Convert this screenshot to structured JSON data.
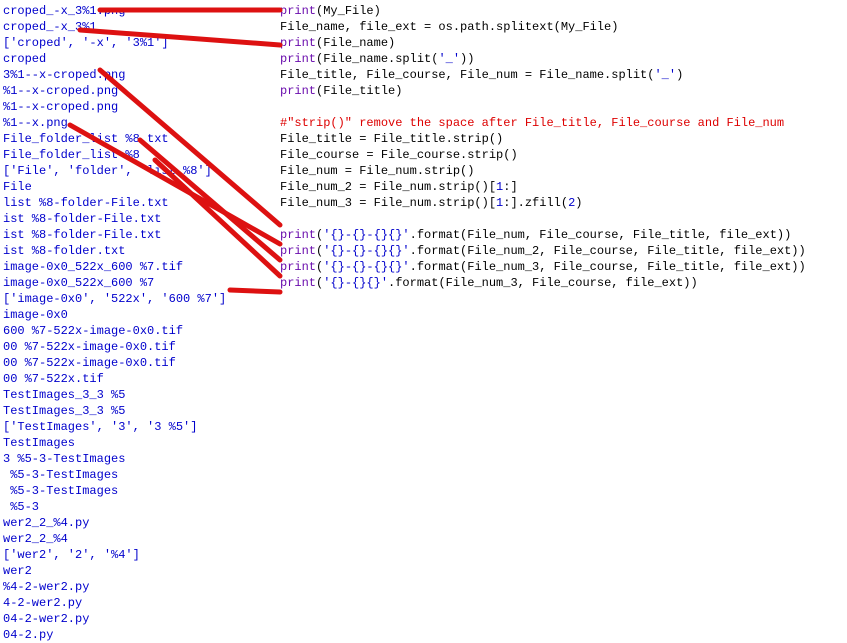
{
  "output": {
    "lines": [
      "croped_-x_3%1.png",
      "croped_-x_3%1",
      "['croped', '-x', '3%1']",
      "croped",
      "3%1--x-croped.png",
      "%1--x-croped.png",
      "%1--x-croped.png",
      "%1--x.png",
      "File_folder_list %8.txt",
      "File_folder_list %8",
      "['File', 'folder', 'list %8']",
      "File",
      "list %8-folder-File.txt",
      "ist %8-folder-File.txt",
      "ist %8-folder-File.txt",
      "ist %8-folder.txt",
      "image-0x0_522x_600 %7.tif",
      "image-0x0_522x_600 %7",
      "['image-0x0', '522x', '600 %7']",
      "image-0x0",
      "600 %7-522x-image-0x0.tif",
      "00 %7-522x-image-0x0.tif",
      "00 %7-522x-image-0x0.tif",
      "00 %7-522x.tif",
      "TestImages_3_3 %5",
      "TestImages_3_3 %5",
      "['TestImages', '3', '3 %5']",
      "TestImages",
      "3 %5-3-TestImages",
      " %5-3-TestImages",
      " %5-3-TestImages",
      " %5-3",
      "wer2_2_%4.py",
      "wer2_2_%4",
      "['wer2', '2', '%4']",
      "wer2",
      "%4-2-wer2.py",
      "4-2-wer2.py",
      "04-2-wer2.py",
      "04-2.py"
    ]
  },
  "code": {
    "l1_fn": "print",
    "l1_rest": "(My_File)",
    "l2": "File_name, file_ext = os.path.splitext(My_File)",
    "l3_fn": "print",
    "l3_rest": "(File_name)",
    "l4_fn": "print",
    "l4_a": "(File_name.split(",
    "l4_str": "'_'",
    "l4_b": "))",
    "l5a": "File_title, File_course, File_num = File_name.split(",
    "l5_str": "'_'",
    "l5b": ")",
    "l6_fn": "print",
    "l6_rest": "(File_title)",
    "l_cmt": "#\"strip()\" remove the space after File_title, File_course and File_num",
    "l8": "File_title = File_title.strip()",
    "l9": "File_course = File_course.strip()",
    "l10": "File_num = File_num.strip()",
    "l11a": "File_num_2 = File_num.strip()[",
    "l11n": "1",
    "l11b": ":]",
    "l12a": "File_num_3 = File_num.strip()[",
    "l12n": "1",
    "l12b": ":].zfill(",
    "l12n2": "2",
    "l12c": ")",
    "p1_fn": "print",
    "p1_a": "(",
    "p1_str": "'{}-{}-{}{}'",
    "p1_b": ".format(File_num, File_course, File_title, file_ext))",
    "p2_fn": "print",
    "p2_a": "(",
    "p2_str": "'{}-{}-{}{}'",
    "p2_b": ".format(File_num_2, File_course, File_title, file_ext))",
    "p3_fn": "print",
    "p3_a": "(",
    "p3_str": "'{}-{}-{}{}'",
    "p3_b": ".format(File_num_3, File_course, File_title, file_ext))",
    "p4_fn": "print",
    "p4_a": "(",
    "p4_str": "'{}-{}{}'",
    "p4_b": ".format(File_num_3, File_course, file_ext))"
  },
  "colors": {
    "output_text": "#0000cc",
    "keyword": "#000088",
    "func": "#6a0dad",
    "string": "#0000cc",
    "comment": "#dd0000",
    "arrow": "#dd1111"
  }
}
